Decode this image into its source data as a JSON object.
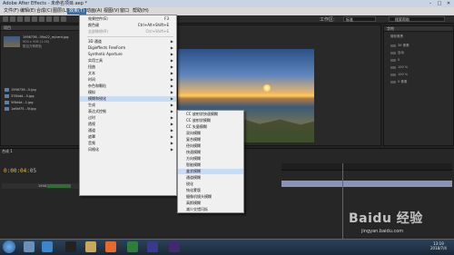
{
  "window": {
    "title": "Adobe After Effects - 未命名项目.aep *",
    "minimize_glyph": "–",
    "maximize_glyph": "□",
    "close_glyph": "✕"
  },
  "menubar": {
    "items": [
      "文件(F)",
      "编辑(E)",
      "合成(C)",
      "图层(L)",
      "效果(T)",
      "动画(A)",
      "视图(V)",
      "窗口",
      "帮助(H)"
    ],
    "active_index": 4
  },
  "toolbar": {
    "workspace_label": "工作区:",
    "workspace_value": "标准",
    "search_placeholder": "搜索帮助"
  },
  "project_panel": {
    "tab": "项目",
    "selected_name": "1956736...59a22_m/cent.jpg",
    "info_line1": "900 x 506 (1.00)",
    "info_line2": "数百万种颜色",
    "files": [
      "1956736...5.jpg",
      "3784dd...5.jpg",
      "5f8d4d...1.jpg",
      "1a6bf75...5f.jpg"
    ]
  },
  "effects_menu": {
    "items": [
      {
        "label": "效果控件(E)",
        "shortcut": "F3"
      },
      {
        "label": "颜色键",
        "shortcut": "Ctrl+Alt+Shift+E"
      },
      {
        "label": "全部移除(R)",
        "shortcut": "Ctrl+Shift+E"
      },
      {
        "label": "3D 通道"
      },
      {
        "label": "Digieffects FreeForm"
      },
      {
        "label": "Synthetic Aperture"
      },
      {
        "label": "实用工具"
      },
      {
        "label": "扭曲"
      },
      {
        "label": "文本"
      },
      {
        "label": "时间"
      },
      {
        "label": "杂色和颗粒"
      },
      {
        "label": "模拟"
      },
      {
        "label": "模糊和锐化"
      },
      {
        "label": "生成"
      },
      {
        "label": "表达式控制"
      },
      {
        "label": "过时"
      },
      {
        "label": "透视"
      },
      {
        "label": "通道"
      },
      {
        "label": "遮罩"
      },
      {
        "label": "音频"
      },
      {
        "label": "风格化"
      }
    ],
    "highlighted_index": 12
  },
  "blur_submenu": {
    "items": [
      "CC 放射状快速模糊",
      "CC 放射状模糊",
      "CC 矢量模糊",
      "双向模糊",
      "复合模糊",
      "径向模糊",
      "快速模糊",
      "方向模糊",
      "智能模糊",
      "盒状模糊",
      "通道模糊",
      "锐化",
      "钝化蒙版",
      "摄像机镜头模糊",
      "高斯模糊",
      "减少交错闪烁"
    ],
    "highlighted_index": 9
  },
  "composition_view": {
    "zoom_label": "50%"
  },
  "timeline": {
    "tab": "合成 1",
    "timecode": "0:00:04:05",
    "layer_name": "1956736...59a22"
  },
  "right_panel": {
    "tab": "字符",
    "font": "微软雅黑",
    "rows": [
      "36 像素",
      "自动",
      "0",
      "100 %",
      "100 %",
      "0 像素"
    ]
  },
  "taskbar": {
    "time": "13:19",
    "date": "2018/7/4"
  },
  "watermark": {
    "brand": "Baidu 经验",
    "url": "jingyan.baidu.com"
  },
  "colors": {
    "accent": "#3a6ea5",
    "timecode": "#e2b84e",
    "menu_highlight": "#c7dcf5"
  }
}
